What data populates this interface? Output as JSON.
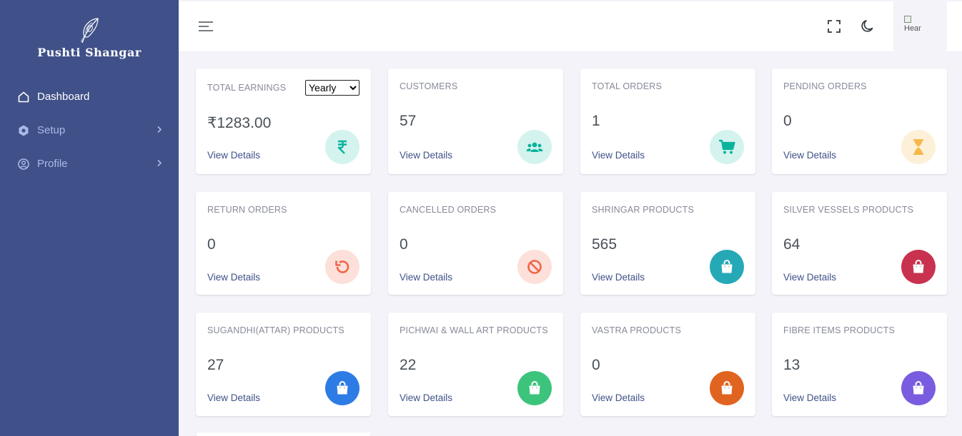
{
  "brand": {
    "name": "Pushti Shangar"
  },
  "sidebar": {
    "items": [
      {
        "label": "Dashboard",
        "icon": "home-icon",
        "active": true
      },
      {
        "label": "Setup",
        "icon": "hexagon-icon",
        "has_children": true
      },
      {
        "label": "Profile",
        "icon": "user-circle-icon",
        "has_children": true
      }
    ]
  },
  "topbar": {
    "avatar_alt": "Hear"
  },
  "cards": [
    {
      "label": "TOTAL EARNINGS",
      "value": "₹1283.00",
      "link": "View Details",
      "icon": "rupee-icon",
      "filter": {
        "selected": "Yearly"
      }
    },
    {
      "label": "CUSTOMERS",
      "value": "57",
      "link": "View Details",
      "icon": "users-icon"
    },
    {
      "label": "TOTAL ORDERS",
      "value": "1",
      "link": "View Details",
      "icon": "cart-icon"
    },
    {
      "label": "PENDING ORDERS",
      "value": "0",
      "link": "View Details",
      "icon": "hourglass-icon"
    },
    {
      "label": "RETURN ORDERS",
      "value": "0",
      "link": "View Details",
      "icon": "undo-icon"
    },
    {
      "label": "CANCELLED ORDERS",
      "value": "0",
      "link": "View Details",
      "icon": "ban-icon"
    },
    {
      "label": "SHRINGAR PRODUCTS",
      "value": "565",
      "link": "View Details",
      "icon": "shopping-bag-icon"
    },
    {
      "label": "SILVER VESSELS PRODUCTS",
      "value": "64",
      "link": "View Details",
      "icon": "shopping-bag-icon"
    },
    {
      "label": "SUGANDHI(ATTAR) PRODUCTS",
      "value": "27",
      "link": "View Details",
      "icon": "shopping-bag-icon"
    },
    {
      "label": "PICHWAI & WALL ART PRODUCTS",
      "value": "22",
      "link": "View Details",
      "icon": "shopping-bag-icon"
    },
    {
      "label": "VASTRA PRODUCTS",
      "value": "0",
      "link": "View Details",
      "icon": "shopping-bag-icon"
    },
    {
      "label": "FIBRE ITEMS PRODUCTS",
      "value": "13",
      "link": "View Details",
      "icon": "shopping-bag-icon"
    }
  ],
  "colors": {
    "sidebar_bg": "#405189",
    "teal": "#0ab39c",
    "amber": "#f7b84b",
    "red": "#f06548",
    "cyan": "#26a9b7",
    "crimson": "#c8324f",
    "blue": "#2d7ce6",
    "green": "#3cc47c",
    "orange": "#e0641f",
    "purple": "#7a5ce0"
  }
}
